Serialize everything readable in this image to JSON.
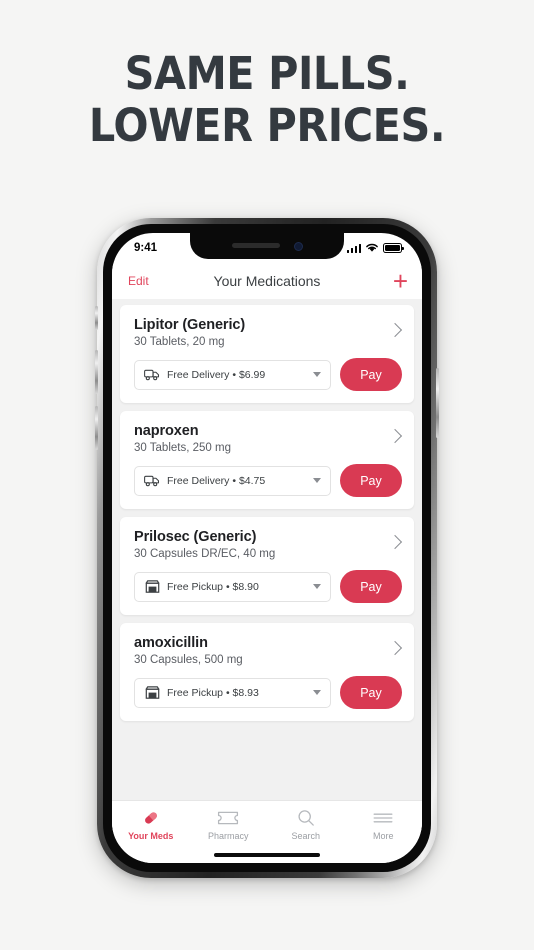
{
  "headline": {
    "line1": "SAME PILLS.",
    "line2": "LOWER PRICES."
  },
  "colors": {
    "brand_red": "#e0455c",
    "pay_red": "#d93a53",
    "headline": "#343a40",
    "page_bg": "#f5f5f4",
    "app_bg": "#f1f1f1"
  },
  "status_bar": {
    "time": "9:41",
    "signal_icon": "cellular-bars-icon",
    "wifi_icon": "wifi-icon",
    "battery_icon": "battery-full-icon"
  },
  "nav": {
    "edit_label": "Edit",
    "title": "Your Medications",
    "add_label": "+",
    "add_icon": "plus-icon"
  },
  "medications": [
    {
      "name": "Lipitor (Generic)",
      "details": "30 Tablets, 20 mg",
      "fulfillment_icon": "delivery-truck-icon",
      "fulfillment": "Free Delivery • $6.99",
      "method": "Free Delivery",
      "price": "$6.99",
      "pay_label": "Pay",
      "chevron_icon": "chevron-right-icon",
      "caret_icon": "caret-down-icon"
    },
    {
      "name": "naproxen",
      "details": "30 Tablets, 250 mg",
      "fulfillment_icon": "delivery-truck-icon",
      "fulfillment": "Free Delivery • $4.75",
      "method": "Free Delivery",
      "price": "$4.75",
      "pay_label": "Pay",
      "chevron_icon": "chevron-right-icon",
      "caret_icon": "caret-down-icon"
    },
    {
      "name": "Prilosec (Generic)",
      "details": "30 Capsules DR/EC, 40 mg",
      "fulfillment_icon": "storefront-icon",
      "fulfillment": "Free Pickup • $8.90",
      "method": "Free Pickup",
      "price": "$8.90",
      "pay_label": "Pay",
      "chevron_icon": "chevron-right-icon",
      "caret_icon": "caret-down-icon"
    },
    {
      "name": "amoxicillin",
      "details": "30 Capsules, 500 mg",
      "fulfillment_icon": "storefront-icon",
      "fulfillment": "Free Pickup • $8.93",
      "method": "Free Pickup",
      "price": "$8.93",
      "pay_label": "Pay",
      "chevron_icon": "chevron-right-icon",
      "caret_icon": "caret-down-icon"
    }
  ],
  "tabs": [
    {
      "label": "Your Meds",
      "icon": "pill-capsule-icon",
      "active": true
    },
    {
      "label": "Pharmacy",
      "icon": "pharmacy-card-icon",
      "active": false
    },
    {
      "label": "Search",
      "icon": "search-icon",
      "active": false
    },
    {
      "label": "More",
      "icon": "hamburger-menu-icon",
      "active": false
    }
  ]
}
